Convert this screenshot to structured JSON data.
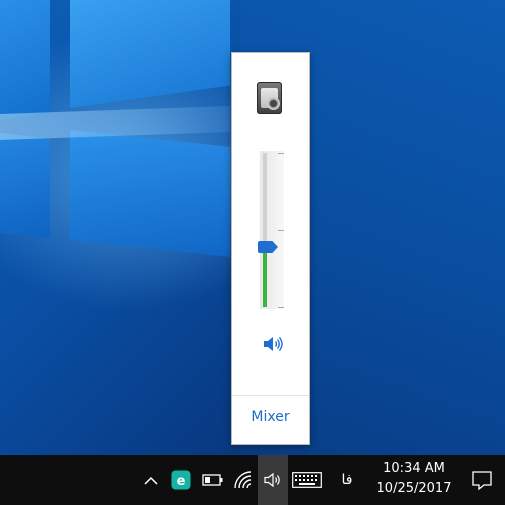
{
  "flyout": {
    "device_icon": "speaker-device-icon",
    "volume_level": 0.39,
    "speaker_icon": "speaker-volume-icon",
    "mixer_label": "Mixer"
  },
  "taskbar": {
    "tray_icons": [
      "chevron-up-icon",
      "eset-icon",
      "battery-icon",
      "wifi-icon",
      "volume-icon",
      "keyboard-icon"
    ],
    "language": "فا",
    "time": "10:34 AM",
    "date": "10/25/2017",
    "notification_icon": "action-center-icon"
  },
  "colors": {
    "accent": "#1f6fd0",
    "volume_fill": "#3cb33c",
    "taskbar": "#0e0e0f",
    "eset": "#17b4a6"
  }
}
